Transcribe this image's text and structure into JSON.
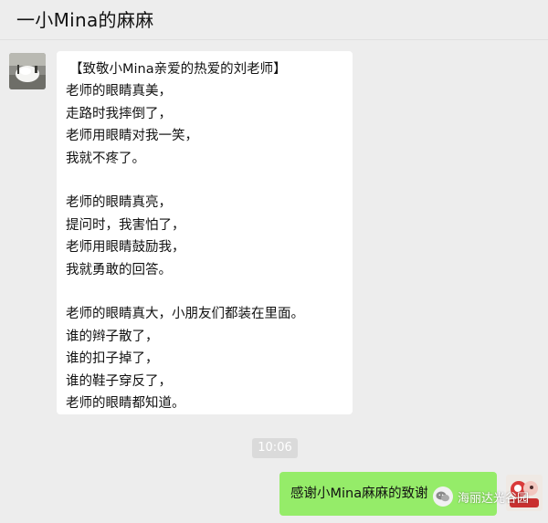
{
  "header": {
    "title": "一小Mina的麻麻"
  },
  "messages": {
    "incoming": {
      "lines": [
        "【致敬小Mina亲爱的热爱的刘老师】",
        "老师的眼睛真美，",
        "走路时我摔倒了，",
        "老师用眼睛对我一笑，",
        "我就不疼了。",
        "",
        "老师的眼睛真亮，",
        "提问时，我害怕了，",
        "老师用眼睛鼓励我，",
        "我就勇敢的回答。",
        "",
        "老师的眼睛真大，小朋友们都装在里面。",
        "谁的辫子散了，",
        "谁的扣子掉了，",
        "谁的鞋子穿反了，",
        "老师的眼睛都知道。"
      ]
    },
    "timestamp": "10:06",
    "outgoing": {
      "text": "感谢小Mina麻麻的致谢"
    }
  },
  "watermark": {
    "text": "海丽达光谷园"
  },
  "colors": {
    "background": "#ededed",
    "bubble_in": "#ffffff",
    "bubble_out": "#95ec69",
    "timestamp_bg": "#dadada"
  }
}
